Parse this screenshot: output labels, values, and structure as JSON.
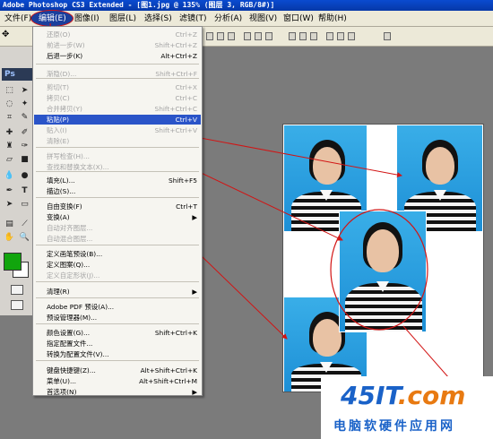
{
  "window": {
    "title": "Adobe Photoshop CS3 Extended - [图1.jpg @ 135% (图层 3, RGB/8#)]"
  },
  "menubar": {
    "items": [
      "文件(F)",
      "编辑(E)",
      "图像(I)",
      "图层(L)",
      "选择(S)",
      "滤镜(T)",
      "分析(A)",
      "视图(V)",
      "窗口(W)",
      "帮助(H)"
    ]
  },
  "toolbox": {
    "logo": "Ps",
    "foreground_color": "#11a50d",
    "background_color": "#ffffff"
  },
  "edit_menu": {
    "items": [
      {
        "label": "还原(O)",
        "shortcut": "Ctrl+Z",
        "disabled": true
      },
      {
        "label": "前进一步(W)",
        "shortcut": "Shift+Ctrl+Z",
        "disabled": true
      },
      {
        "label": "后退一步(K)",
        "shortcut": "Alt+Ctrl+Z",
        "disabled": false
      },
      {
        "label": "渐隐(D)...",
        "shortcut": "Shift+Ctrl+F",
        "disabled": true
      },
      {
        "label": "剪切(T)",
        "shortcut": "Ctrl+X",
        "disabled": true
      },
      {
        "label": "拷贝(C)",
        "shortcut": "Ctrl+C",
        "disabled": true
      },
      {
        "label": "合并拷贝(Y)",
        "shortcut": "Shift+Ctrl+C",
        "disabled": true
      },
      {
        "label": "粘贴(P)",
        "shortcut": "Ctrl+V",
        "disabled": false,
        "highlighted": true
      },
      {
        "label": "贴入(I)",
        "shortcut": "Shift+Ctrl+V",
        "disabled": true
      },
      {
        "label": "清除(E)",
        "shortcut": "",
        "disabled": true
      },
      {
        "label": "拼写检查(H)...",
        "shortcut": "",
        "disabled": true
      },
      {
        "label": "查找和替换文本(X)...",
        "shortcut": "",
        "disabled": true
      },
      {
        "label": "填充(L)...",
        "shortcut": "Shift+F5",
        "disabled": false
      },
      {
        "label": "描边(S)...",
        "shortcut": "",
        "disabled": false
      },
      {
        "label": "自由变换(F)",
        "shortcut": "Ctrl+T",
        "disabled": false
      },
      {
        "label": "变换(A)",
        "shortcut": "▶",
        "disabled": false
      },
      {
        "label": "自动对齐图层...",
        "shortcut": "",
        "disabled": true
      },
      {
        "label": "自动混合图层...",
        "shortcut": "",
        "disabled": true
      },
      {
        "label": "定义画笔预设(B)...",
        "shortcut": "",
        "disabled": false
      },
      {
        "label": "定义图案(Q)...",
        "shortcut": "",
        "disabled": false
      },
      {
        "label": "定义自定形状(J)...",
        "shortcut": "",
        "disabled": true
      },
      {
        "label": "清理(R)",
        "shortcut": "▶",
        "disabled": false
      },
      {
        "label": "Adobe PDF 预设(A)...",
        "shortcut": "",
        "disabled": false
      },
      {
        "label": "预设管理器(M)...",
        "shortcut": "",
        "disabled": false
      },
      {
        "label": "颜色设置(G)...",
        "shortcut": "Shift+Ctrl+K",
        "disabled": false
      },
      {
        "label": "指定配置文件...",
        "shortcut": "",
        "disabled": false
      },
      {
        "label": "转换为配置文件(V)...",
        "shortcut": "",
        "disabled": false
      },
      {
        "label": "键盘快捷键(Z)...",
        "shortcut": "Alt+Shift+Ctrl+K",
        "disabled": false
      },
      {
        "label": "菜单(U)...",
        "shortcut": "Alt+Shift+Ctrl+M",
        "disabled": false
      },
      {
        "label": "首选项(N)",
        "shortcut": "▶",
        "disabled": false
      }
    ]
  },
  "watermark": {
    "logo_main": "45IT",
    "logo_suffix": ".com",
    "tagline": "电脑软硬件应用网"
  },
  "colors": {
    "highlight": "#2a54c8",
    "annotation": "#d21414",
    "title_bar": "#0a4bd0"
  }
}
